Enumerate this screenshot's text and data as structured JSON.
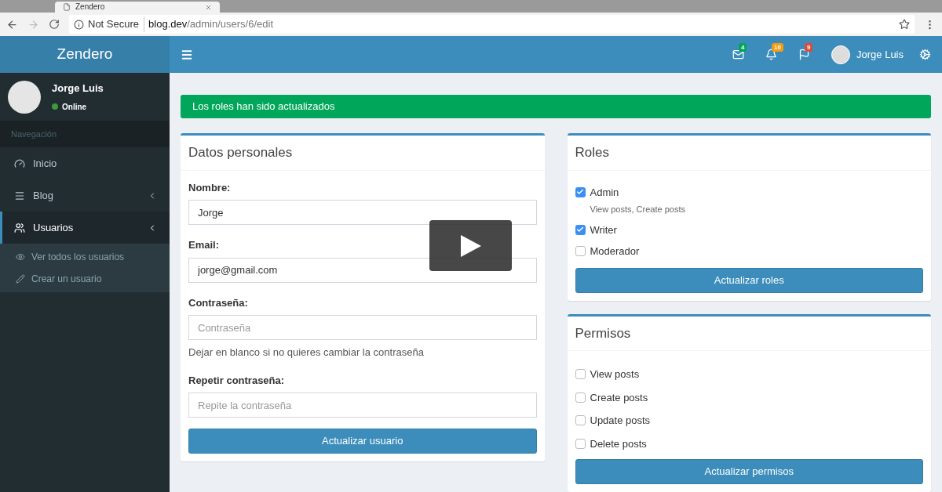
{
  "browser": {
    "tab_title": "Zendero",
    "security_label": "Not Secure",
    "url_host": "blog.dev",
    "url_path": "/admin/users/6/edit"
  },
  "header": {
    "brand": "Zendero",
    "notifications": [
      {
        "kind": "mail",
        "count": "4",
        "color": "#00a65a"
      },
      {
        "kind": "bell",
        "count": "10",
        "color": "#f39c12"
      },
      {
        "kind": "flag",
        "count": "9",
        "color": "#dd4b39"
      }
    ],
    "user_name": "Jorge Luis"
  },
  "sidebar": {
    "user": {
      "name": "Jorge Luis",
      "status": "Online",
      "online": true
    },
    "section": "Navegación",
    "items": [
      {
        "label": "Inicio",
        "kind": "dashboard",
        "selected": false
      },
      {
        "label": "Blog",
        "kind": "list",
        "selected": false
      },
      {
        "label": "Usuarios",
        "kind": "users",
        "selected": true,
        "children": [
          {
            "label": "Ver todos los usuarios",
            "kind": "eye"
          },
          {
            "label": "Crear un usuario",
            "kind": "pencil"
          }
        ]
      }
    ]
  },
  "alert": {
    "text": "Los roles han sido actualizados"
  },
  "personal": {
    "title": "Datos personales",
    "fields": [
      {
        "label": "Nombre:",
        "value": "Jorge"
      },
      {
        "label": "Email:",
        "value": "jorge@gmail.com"
      },
      {
        "label": "Contraseña:",
        "placeholder": "Contraseña",
        "help": "Dejar en blanco si no quieres cambiar la contraseña"
      },
      {
        "label": "Repetir contraseña:",
        "placeholder": "Repite la contraseña"
      }
    ],
    "button": "Actualizar usuario"
  },
  "roles": {
    "title": "Roles",
    "items": [
      {
        "label": "Admin",
        "checked": true,
        "description": "View posts, Create posts"
      },
      {
        "label": "Writer",
        "checked": true
      },
      {
        "label": "Moderador",
        "checked": false
      }
    ],
    "button": "Actualizar roles"
  },
  "permissions": {
    "title": "Permisos",
    "items": [
      {
        "label": "View posts",
        "checked": false
      },
      {
        "label": "Create posts",
        "checked": false
      },
      {
        "label": "Update posts",
        "checked": false
      },
      {
        "label": "Delete posts",
        "checked": false
      }
    ],
    "button": "Actualizar permisos"
  },
  "video": {
    "play_button": true
  }
}
